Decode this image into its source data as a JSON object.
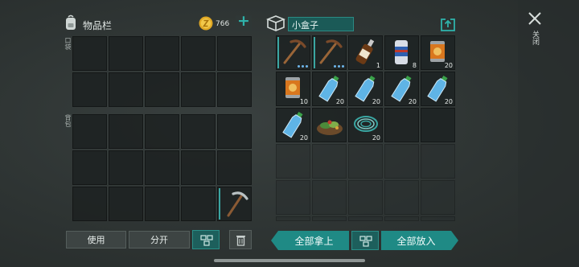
{
  "inventory": {
    "title": "物品栏",
    "coin_count": "766",
    "pocket_label": "口袋",
    "backpack_label": "背包",
    "add_symbol": "+"
  },
  "actions": {
    "use_label": "使用",
    "split_label": "分开"
  },
  "container": {
    "title": "小盒子",
    "take_all_label": "全部拿上",
    "put_all_label": "全部放入",
    "items": [
      {
        "name": "pickaxe",
        "count": ""
      },
      {
        "name": "pickaxe",
        "count": ""
      },
      {
        "name": "whiskey-bottle",
        "count": "1"
      },
      {
        "name": "soda-can",
        "count": "8"
      },
      {
        "name": "canned-food",
        "count": "20"
      },
      {
        "name": "canned-food",
        "count": "10"
      },
      {
        "name": "water-bottle",
        "count": "20"
      },
      {
        "name": "water-bottle",
        "count": "20"
      },
      {
        "name": "water-bottle",
        "count": "20"
      },
      {
        "name": "water-bottle",
        "count": "20"
      },
      {
        "name": "water-bottle",
        "count": "20"
      },
      {
        "name": "herb-pile",
        "count": ""
      },
      {
        "name": "wire-coil",
        "count": "20"
      }
    ]
  },
  "close_label": "关闭",
  "colors": {
    "accent": "#1f8a85",
    "coin": "#e0a824"
  }
}
